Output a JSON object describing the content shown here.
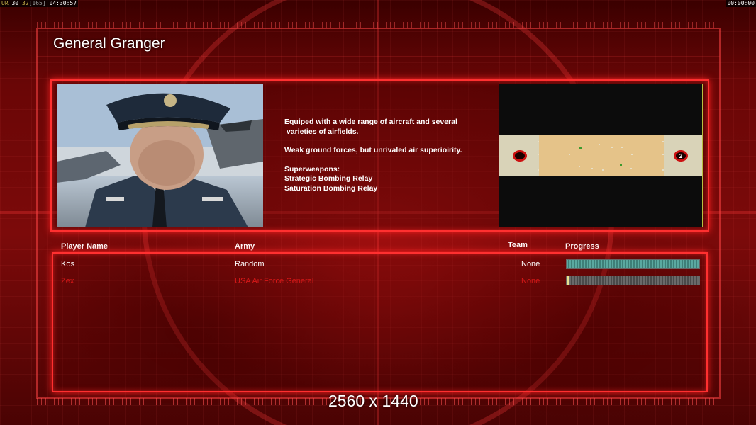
{
  "hud": {
    "left_prefix": "UR",
    "fps": "30",
    "avg": "32",
    "bracket": "[165]",
    "time_left": "04:30:57",
    "time_right": "00:00:00"
  },
  "general_title": "General Granger",
  "description": {
    "line1": "Equiped with a wide range of aircraft and several\n varieties of airfields.",
    "line2": "Weak ground forces, but unrivaled air superioirity.",
    "superweapons_header": "Superweapons:",
    "superweapon1": "Strategic Bombing Relay",
    "superweapon2": "Saturation Bombing Relay"
  },
  "map": {
    "start2_label": "2"
  },
  "table": {
    "headers": {
      "player": "Player Name",
      "army": "Army",
      "team": "Team",
      "progress": "Progress"
    },
    "rows": [
      {
        "player": "Kos",
        "army": "Random",
        "team": "None",
        "progress": 1.0,
        "color": "#ffffff"
      },
      {
        "player": "Zex",
        "army": "USA Air Force General",
        "team": "None",
        "progress": 0.02,
        "color": "#d81818"
      }
    ]
  },
  "resolution_label": "2560 x 1440",
  "colors": {
    "accent": "#ff3030",
    "background": "#7c0a0a",
    "player2": "#d81818"
  }
}
